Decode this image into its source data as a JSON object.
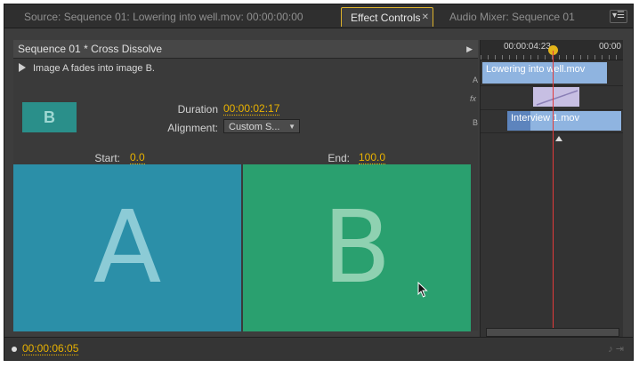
{
  "tabs": {
    "source": "Source: Sequence 01: Lowering into well.mov: 00:00:00:00",
    "effect_controls": "Effect Controls",
    "audio_mixer": "Audio Mixer: Sequence 01"
  },
  "panel": {
    "sequence_title": "Sequence 01 * Cross Dissolve",
    "description": "Image A fades into image B.",
    "duration_label": "Duration",
    "duration_value": "00:00:02:17",
    "alignment_label": "Alignment:",
    "alignment_value": "Custom S...",
    "start_label": "Start:",
    "start_value": "0.0",
    "end_label": "End:",
    "end_value": "100.0",
    "thumb_letter": "B",
    "preview_a_letter": "A",
    "preview_b_letter": "B"
  },
  "timeline": {
    "timecode_current": "00:00:04:23",
    "timecode_right": "00:00",
    "track_a_label": "A",
    "track_fx_label": "fx",
    "track_b_label": "B",
    "clip_a_name": "Lowering into well.mov",
    "clip_b_name": "Interview 1.mov"
  },
  "footer": {
    "timecode": "00:00:06:05"
  },
  "colors": {
    "accent_timecode": "#e9b200",
    "preview_a": "#2b8fa8",
    "preview_b": "#2aa06f",
    "clip": "#8fb4e0",
    "playhead": "#e23a3a"
  }
}
